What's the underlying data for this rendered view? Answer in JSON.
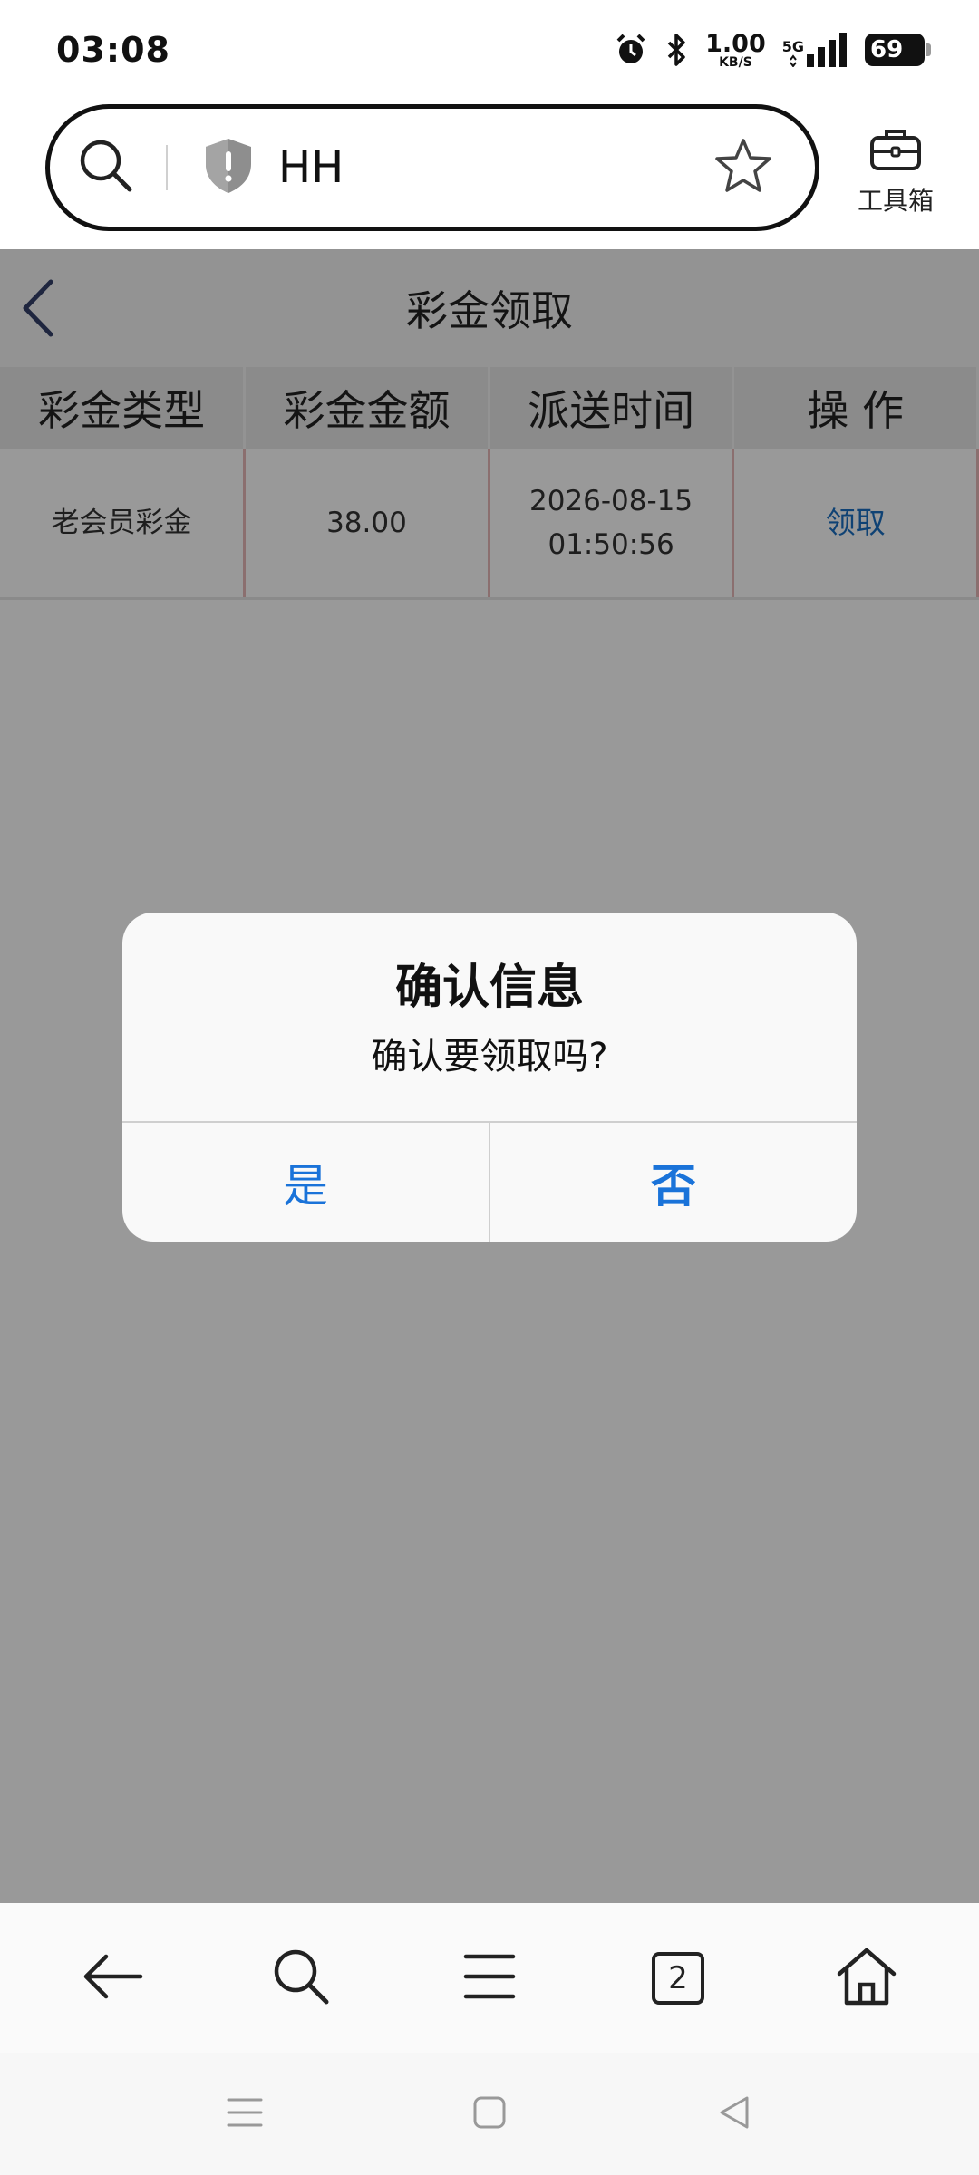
{
  "status_bar": {
    "time": "03:08",
    "net_speed": "1.00",
    "net_unit": "KB/S",
    "signal_label": "5G",
    "battery": "69"
  },
  "browser": {
    "url_text": "HH",
    "toolbox_label": "工具箱"
  },
  "page": {
    "title": "彩金领取"
  },
  "table": {
    "headers": [
      "彩金类型",
      "彩金金额",
      "派送时间",
      "操 作"
    ],
    "rows": [
      {
        "type": "老会员彩金",
        "amount": "38.00",
        "date": "2026-08-15",
        "time": "01:50:56",
        "action": "领取"
      }
    ]
  },
  "dialog": {
    "title": "确认信息",
    "message": "确认要领取吗?",
    "yes_label": "是",
    "no_label": "否"
  },
  "bottom_nav": {
    "tab_count": "2"
  },
  "colors": {
    "link_blue": "#1a6fc2",
    "dialog_button_blue": "#1a73d9",
    "overlay": "rgba(0,0,0,0.40)"
  }
}
